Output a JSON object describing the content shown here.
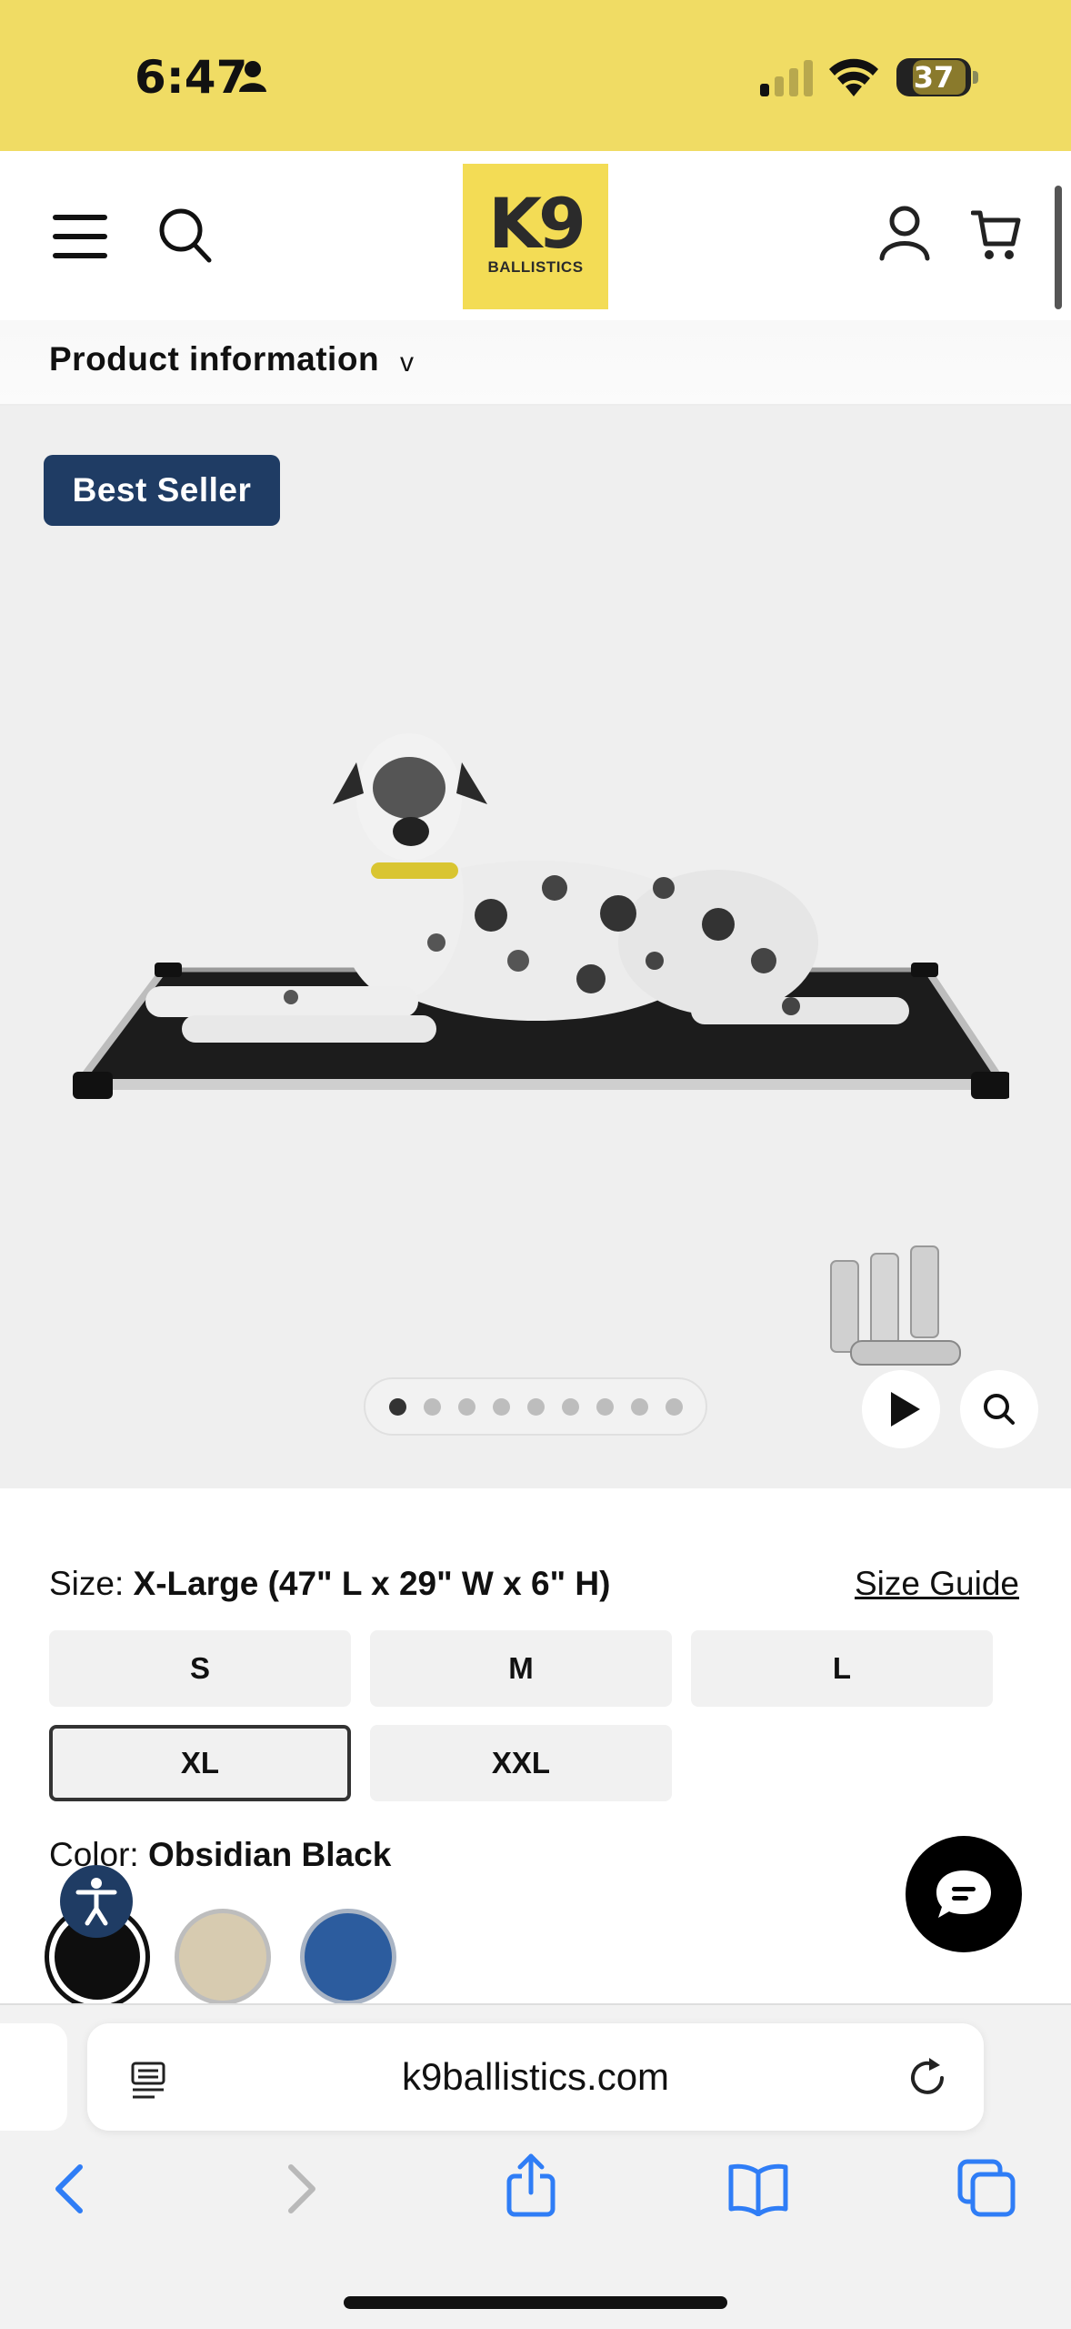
{
  "status_bar": {
    "time": "6:47",
    "battery": "37",
    "colors": {
      "background": "#f0dc64"
    }
  },
  "header": {
    "logo": {
      "main": "K9",
      "sub": "BALLISTICS"
    },
    "icons": [
      "menu-icon",
      "search-icon",
      "account-icon",
      "cart-icon"
    ]
  },
  "product_info": {
    "label": "Product information",
    "chevron": "v"
  },
  "gallery": {
    "badge": "Best Seller",
    "dot_count": 9,
    "active_dot": 1,
    "icons": [
      "play-icon",
      "zoom-icon"
    ]
  },
  "options": {
    "size_label": "Size:",
    "size_value": "X-Large (47\" L x 29\" W x 6\" H)",
    "size_guide": "Size Guide",
    "sizes": [
      {
        "label": "S",
        "selected": false
      },
      {
        "label": "M",
        "selected": false
      },
      {
        "label": "L",
        "selected": false
      },
      {
        "label": "XL",
        "selected": true
      },
      {
        "label": "XXL",
        "selected": false
      }
    ],
    "color_label": "Color:",
    "color_value": "Obsidian Black",
    "swatches": [
      {
        "name": "black",
        "hex": "#0e0e0e",
        "selected": true
      },
      {
        "name": "tan",
        "hex": "#d7cbb0",
        "selected": false
      },
      {
        "name": "blue",
        "hex": "#2c5c9e",
        "selected": false
      }
    ]
  },
  "browser": {
    "url": "k9ballistics.com",
    "icons": [
      "reader-icon",
      "reload-icon",
      "back-icon",
      "forward-icon",
      "share-icon",
      "bookmarks-icon",
      "tabs-icon"
    ]
  },
  "colors": {
    "accent_yellow": "#f3dc55",
    "badge_navy": "#1f3c64",
    "link_blue": "#2f7df6"
  }
}
